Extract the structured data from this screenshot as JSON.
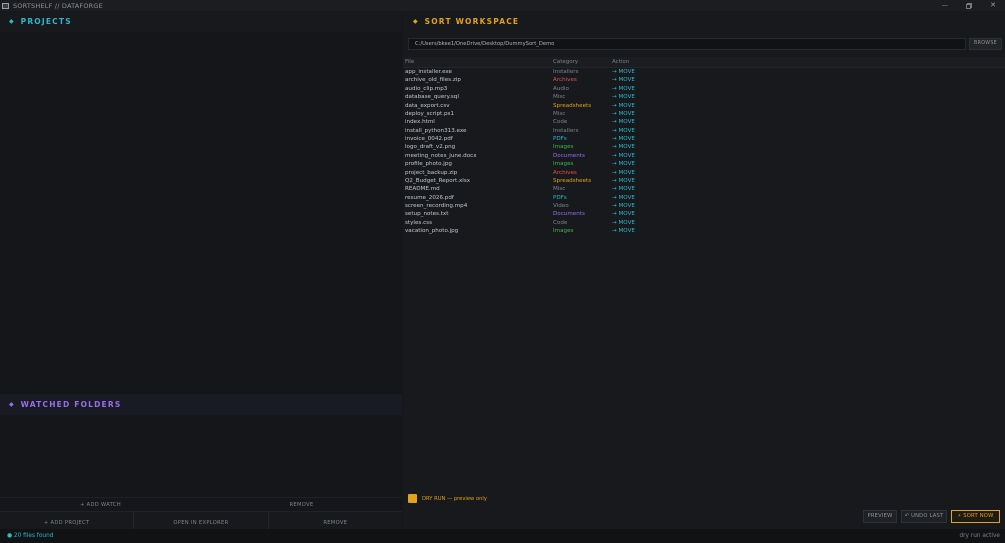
{
  "window": {
    "title": "SORTSHELF  //  DATAFORGE",
    "minimize_glyph": "—",
    "close_glyph": "✕"
  },
  "projects": {
    "title": "PROJECTS",
    "add_label": "+ ADD PROJECT",
    "open_label": "OPEN IN EXPLORER",
    "remove_label": "REMOVE"
  },
  "watched": {
    "title": "WATCHED FOLDERS",
    "add_label": "+ ADD WATCH",
    "remove_label": "REMOVE"
  },
  "workspace": {
    "title": "SORT WORKSPACE",
    "path": "C:/Users/bkee1/OneDrive/Desktop/DummySort_Demo",
    "browse_label": "BROWSE",
    "columns": {
      "file": "File",
      "category": "Category",
      "action": "Action"
    },
    "files": [
      {
        "name": "app_installer.exe",
        "category": "Installers",
        "action": "→ MOVE"
      },
      {
        "name": "archive_old_files.zip",
        "category": "Archives",
        "action": "→ MOVE"
      },
      {
        "name": "audio_clip.mp3",
        "category": "Audio",
        "action": "→ MOVE"
      },
      {
        "name": "database_query.sql",
        "category": "Misc",
        "action": "→ MOVE"
      },
      {
        "name": "data_export.csv",
        "category": "Spreadsheets",
        "action": "→ MOVE"
      },
      {
        "name": "deploy_script.ps1",
        "category": "Misc",
        "action": "→ MOVE"
      },
      {
        "name": "index.html",
        "category": "Code",
        "action": "→ MOVE"
      },
      {
        "name": "install_python313.exe",
        "category": "Installers",
        "action": "→ MOVE"
      },
      {
        "name": "invoice_0042.pdf",
        "category": "PDFs",
        "action": "→ MOVE"
      },
      {
        "name": "logo_draft_v2.png",
        "category": "Images",
        "action": "→ MOVE"
      },
      {
        "name": "meeting_notes_june.docx",
        "category": "Documents",
        "action": "→ MOVE"
      },
      {
        "name": "profile_photo.jpg",
        "category": "Images",
        "action": "→ MOVE"
      },
      {
        "name": "project_backup.zip",
        "category": "Archives",
        "action": "→ MOVE"
      },
      {
        "name": "Q2_Budget_Report.xlsx",
        "category": "Spreadsheets",
        "action": "→ MOVE"
      },
      {
        "name": "README.md",
        "category": "Misc",
        "action": "→ MOVE"
      },
      {
        "name": "resume_2026.pdf",
        "category": "PDFs",
        "action": "→ MOVE"
      },
      {
        "name": "screen_recording.mp4",
        "category": "Video",
        "action": "→ MOVE"
      },
      {
        "name": "setup_notes.txt",
        "category": "Documents",
        "action": "→ MOVE"
      },
      {
        "name": "styles.css",
        "category": "Code",
        "action": "→ MOVE"
      },
      {
        "name": "vacation_photo.jpg",
        "category": "Images",
        "action": "→ MOVE"
      }
    ],
    "category_colors": {
      "Installers": "#7d8590",
      "Archives": "#e5534b",
      "Audio": "#7d8590",
      "Misc": "#7d8590",
      "Spreadsheets": "#e3a21a",
      "Code": "#7d8590",
      "PDFs": "#2bb8cc",
      "Images": "#3fb950",
      "Documents": "#9b6cf0",
      "Video": "#7d8590"
    },
    "dry_run_label": "DRY RUN — preview only",
    "preview_label": "PREVIEW",
    "undo_label": "↶ UNDO LAST",
    "sort_label": "⚡ SORT NOW"
  },
  "status": {
    "files_found": "● 20 files found",
    "mode": "dry run active"
  },
  "icons": {
    "section": "diamond-icon",
    "window": "app-icon"
  },
  "colors": {
    "accent_cyan": "#2bb8cc",
    "accent_purple": "#9b6cf0",
    "accent_amber": "#e3a21a"
  }
}
